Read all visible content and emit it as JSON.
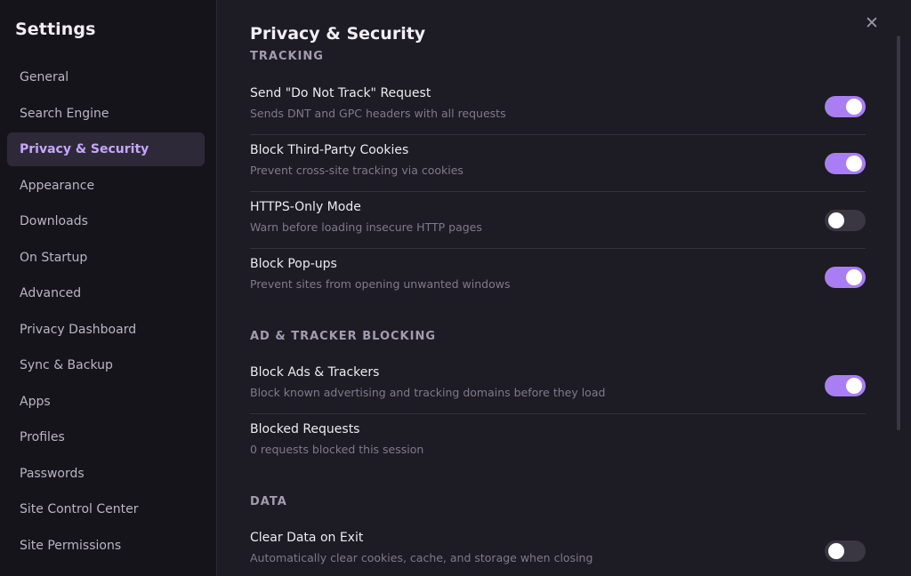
{
  "sidebar": {
    "title": "Settings",
    "items": [
      {
        "label": "General"
      },
      {
        "label": "Search Engine"
      },
      {
        "label": "Privacy & Security"
      },
      {
        "label": "Appearance"
      },
      {
        "label": "Downloads"
      },
      {
        "label": "On Startup"
      },
      {
        "label": "Advanced"
      },
      {
        "label": "Privacy Dashboard"
      },
      {
        "label": "Sync & Backup"
      },
      {
        "label": "Apps"
      },
      {
        "label": "Profiles"
      },
      {
        "label": "Passwords"
      },
      {
        "label": "Site Control Center"
      },
      {
        "label": "Site Permissions"
      }
    ],
    "active_item": "Privacy & Security"
  },
  "main": {
    "title": "Privacy & Security",
    "close_icon": "close-icon",
    "sections": [
      {
        "label": "TRACKING",
        "rows": [
          {
            "title": "Send \"Do Not Track\" Request",
            "desc": "Sends DNT and GPC headers with all requests",
            "toggle": true
          },
          {
            "title": "Block Third-Party Cookies",
            "desc": "Prevent cross-site tracking via cookies",
            "toggle": true
          },
          {
            "title": "HTTPS-Only Mode",
            "desc": "Warn before loading insecure HTTP pages",
            "toggle": false
          },
          {
            "title": "Block Pop-ups",
            "desc": "Prevent sites from opening unwanted windows",
            "toggle": true
          }
        ]
      },
      {
        "label": "AD & TRACKER BLOCKING",
        "rows": [
          {
            "title": "Block Ads & Trackers",
            "desc": "Block known advertising and tracking domains before they load",
            "toggle": true
          },
          {
            "title": "Blocked Requests",
            "desc": "0 requests blocked this session"
          }
        ]
      },
      {
        "label": "DATA",
        "rows": [
          {
            "title": "Clear Data on Exit",
            "desc": "Automatically clear cookies, cache, and storage when closing",
            "toggle": false
          }
        ]
      }
    ]
  },
  "colors": {
    "accent": "#a97ef3",
    "active_text": "#c6a6ff",
    "background": "#1d1b23",
    "sidebar_background": "#16141b"
  }
}
